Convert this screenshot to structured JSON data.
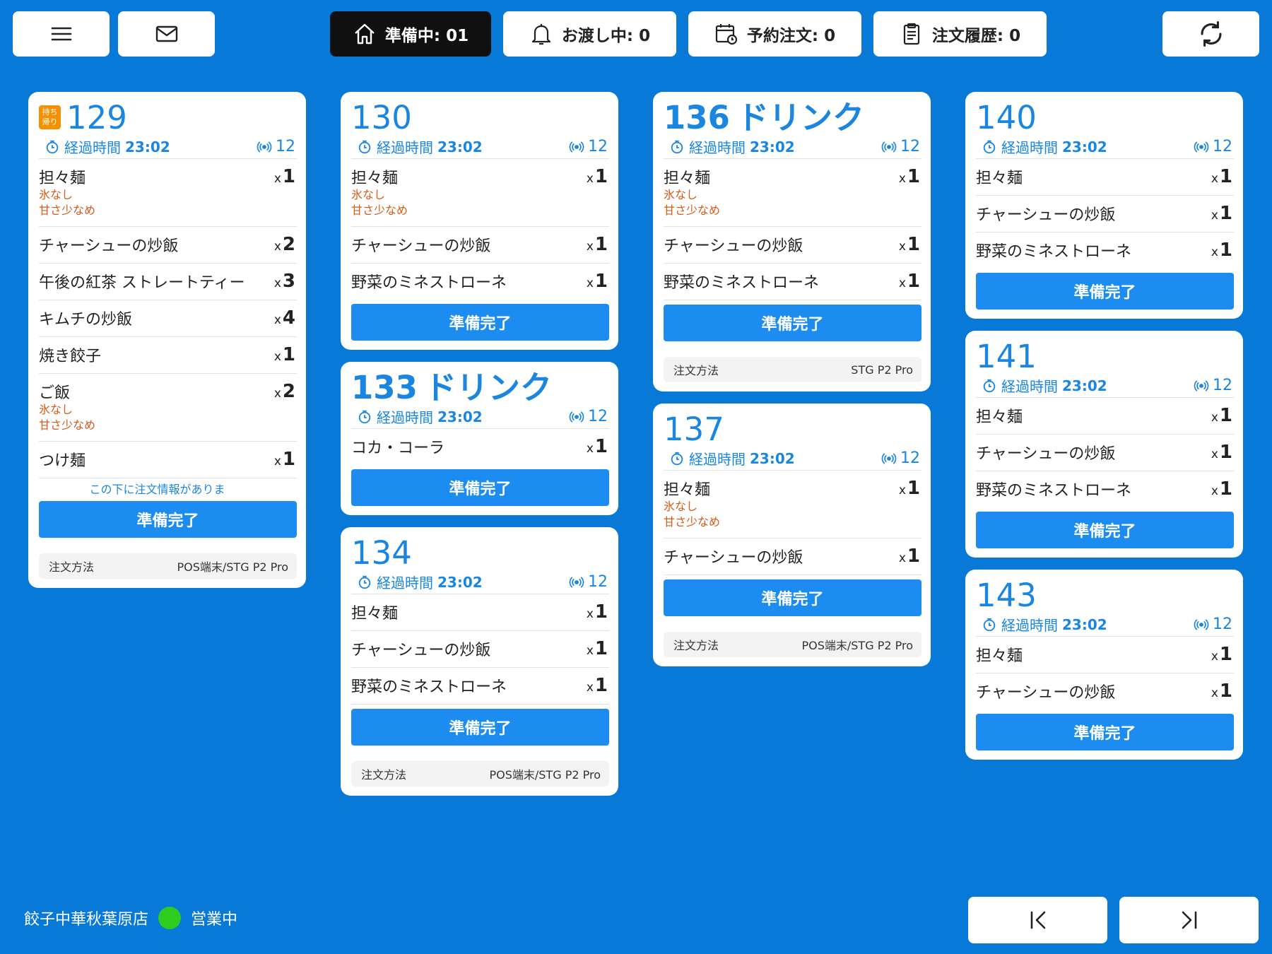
{
  "topbar": {
    "preparing": "準備中: 01",
    "handing": "お渡し中: 0",
    "reservation": "予約注文: 0",
    "history": "注文履歴: 0"
  },
  "common": {
    "elapsed_label": "経過時間",
    "done_label": "準備完了",
    "method_label": "注文方法",
    "qty_prefix": "x"
  },
  "orders": [
    {
      "no": "129",
      "suffix": "",
      "takeout": "持ち帰り",
      "elapsed": "23:02",
      "device": "12",
      "items": [
        {
          "name": "担々麺",
          "qty": "1",
          "notes": [
            "氷なし",
            "甘さ少なめ"
          ]
        },
        {
          "name": "チャーシューの炒飯",
          "qty": "2",
          "notes": []
        },
        {
          "name": "午後の紅茶 ストレートティー",
          "qty": "3",
          "notes": []
        },
        {
          "name": "キムチの炒飯",
          "qty": "4",
          "notes": []
        },
        {
          "name": "焼き餃子",
          "qty": "1",
          "notes": []
        },
        {
          "name": "ご飯",
          "qty": "2",
          "notes": [
            "氷なし",
            "甘さ少なめ"
          ]
        },
        {
          "name": "つけ麺",
          "qty": "1",
          "notes": []
        }
      ],
      "more": "この下に注文情報がありま",
      "method": "POS端末/STG P2 Pro"
    },
    {
      "no": "130",
      "suffix": "",
      "elapsed": "23:02",
      "device": "12",
      "items": [
        {
          "name": "担々麺",
          "qty": "1",
          "notes": [
            "氷なし",
            "甘さ少なめ"
          ]
        },
        {
          "name": "チャーシューの炒飯",
          "qty": "1",
          "notes": []
        },
        {
          "name": "野菜のミネストローネ",
          "qty": "1",
          "notes": []
        }
      ]
    },
    {
      "no": "133",
      "suffix": "ドリンク",
      "elapsed": "23:02",
      "device": "12",
      "items": [
        {
          "name": "コカ・コーラ",
          "qty": "1",
          "notes": []
        }
      ]
    },
    {
      "no": "134",
      "suffix": "",
      "elapsed": "23:02",
      "device": "12",
      "items": [
        {
          "name": "担々麺",
          "qty": "1",
          "notes": []
        },
        {
          "name": "チャーシューの炒飯",
          "qty": "1",
          "notes": []
        },
        {
          "name": "野菜のミネストローネ",
          "qty": "1",
          "notes": []
        }
      ],
      "method": "POS端末/STG P2 Pro"
    },
    {
      "no": "136",
      "suffix": "ドリンク",
      "elapsed": "23:02",
      "device": "12",
      "items": [
        {
          "name": "担々麺",
          "qty": "1",
          "notes": [
            "氷なし",
            "甘さ少なめ"
          ]
        },
        {
          "name": "チャーシューの炒飯",
          "qty": "1",
          "notes": []
        },
        {
          "name": "野菜のミネストローネ",
          "qty": "1",
          "notes": []
        }
      ],
      "method": "STG P2 Pro"
    },
    {
      "no": "137",
      "suffix": "",
      "elapsed": "23:02",
      "device": "12",
      "items": [
        {
          "name": "担々麺",
          "qty": "1",
          "notes": [
            "氷なし",
            "甘さ少なめ"
          ]
        },
        {
          "name": "チャーシューの炒飯",
          "qty": "1",
          "notes": []
        }
      ],
      "method": "POS端末/STG P2 Pro"
    },
    {
      "no": "140",
      "suffix": "",
      "elapsed": "23:02",
      "device": "12",
      "items": [
        {
          "name": "担々麺",
          "qty": "1",
          "notes": []
        },
        {
          "name": "チャーシューの炒飯",
          "qty": "1",
          "notes": []
        },
        {
          "name": "野菜のミネストローネ",
          "qty": "1",
          "notes": []
        }
      ]
    },
    {
      "no": "141",
      "suffix": "",
      "elapsed": "23:02",
      "device": "12",
      "items": [
        {
          "name": "担々麺",
          "qty": "1",
          "notes": []
        },
        {
          "name": "チャーシューの炒飯",
          "qty": "1",
          "notes": []
        },
        {
          "name": "野菜のミネストローネ",
          "qty": "1",
          "notes": []
        }
      ]
    },
    {
      "no": "143",
      "suffix": "",
      "elapsed": "23:02",
      "device": "12",
      "items": [
        {
          "name": "担々麺",
          "qty": "1",
          "notes": []
        },
        {
          "name": "チャーシューの炒飯",
          "qty": "1",
          "notes": []
        }
      ]
    }
  ],
  "footer": {
    "store": "餃子中華秋葉原店",
    "status": "営業中",
    "status_color": "#2fcc1f"
  }
}
